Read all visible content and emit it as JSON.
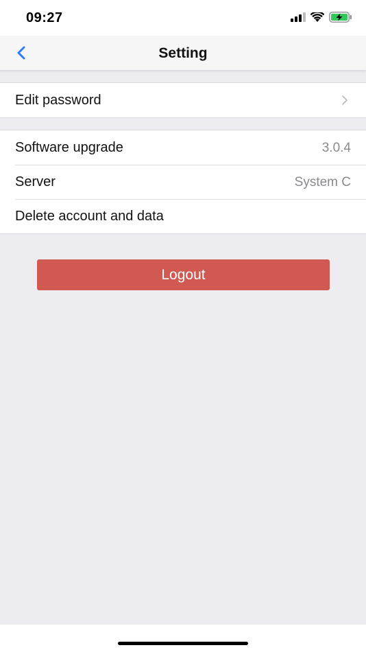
{
  "status_bar": {
    "time": "09:27",
    "icons": [
      "signal-icon",
      "wifi-icon",
      "battery-charging-icon"
    ]
  },
  "nav": {
    "back_icon": "chevron-left-icon",
    "title": "Setting"
  },
  "groups": [
    {
      "rows": [
        {
          "label": "Edit password",
          "value": "",
          "accessory": "chevron-right-icon"
        }
      ]
    },
    {
      "rows": [
        {
          "label": "Software upgrade",
          "value": "3.0.4"
        },
        {
          "label": "Server",
          "value": "System C"
        },
        {
          "label": "Delete account and data",
          "value": ""
        }
      ]
    }
  ],
  "logout": {
    "label": "Logout"
  },
  "colors": {
    "accent": "#2f7cf6",
    "logout_bg": "#d05a52",
    "background": "#edecf1",
    "battery": "#34c759"
  }
}
